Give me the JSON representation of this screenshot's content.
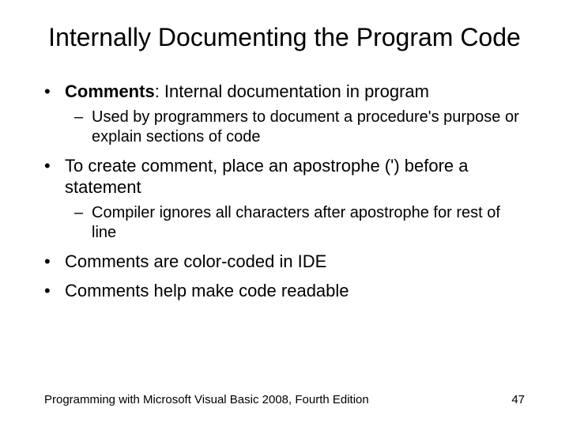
{
  "title": "Internally Documenting the Program Code",
  "bullets": {
    "b1_term": "Comments",
    "b1_rest": ": Internal documentation in program",
    "b1_sub1": "Used by programmers to document a procedure's purpose or explain sections of code",
    "b2": "To create comment, place an apostrophe (') before a statement",
    "b2_sub1": "Compiler ignores all characters after apostrophe for rest of line",
    "b3": "Comments are color-coded in IDE",
    "b4": "Comments help make code readable"
  },
  "footer": {
    "source": "Programming with Microsoft Visual Basic 2008, Fourth Edition",
    "page": "47"
  },
  "glyphs": {
    "bullet": "•",
    "dash": "–"
  }
}
